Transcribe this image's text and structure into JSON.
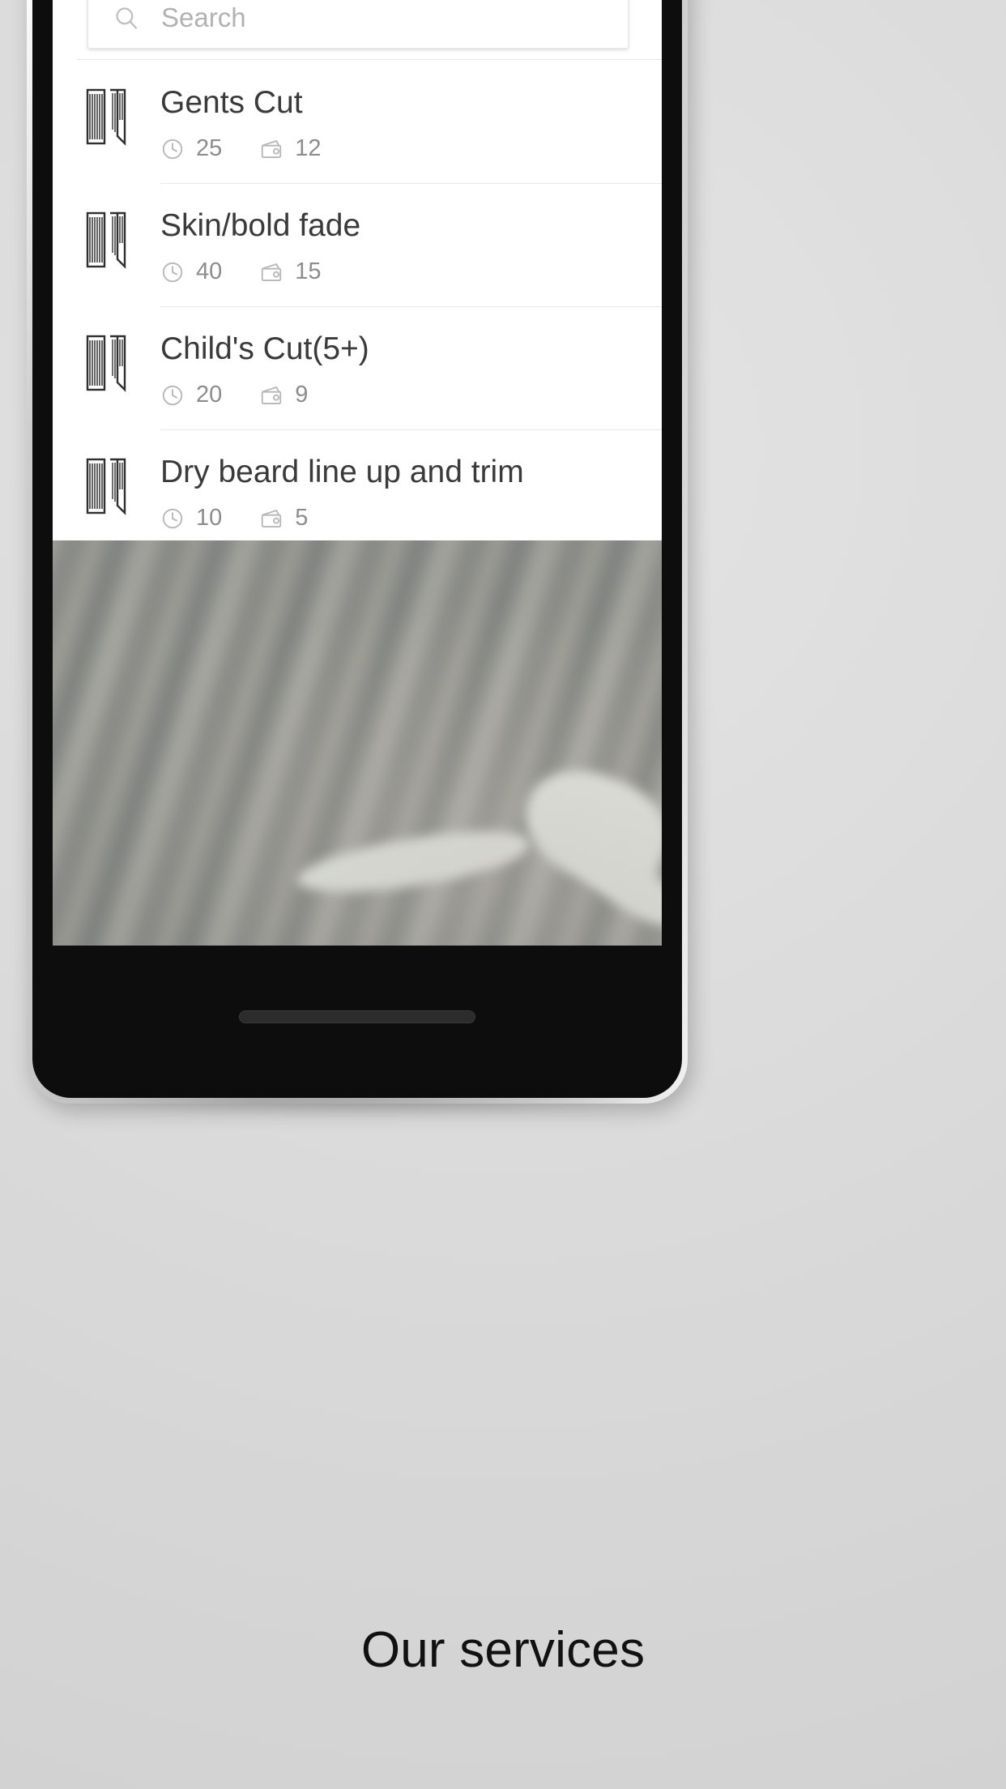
{
  "caption": "Our services",
  "search": {
    "placeholder": "Search",
    "value": "",
    "icon": "search-icon"
  },
  "icons": {
    "service": "comb-icon",
    "duration": "clock-icon",
    "price": "wallet-icon"
  },
  "colors": {
    "screen_background": "#ffffff",
    "page_background": "#dedede",
    "title_text": "#3a3a3a",
    "meta_text": "#8c8c8c",
    "placeholder_text": "#b2b2b2",
    "divider": "#e8e8e8",
    "bezel": "#0d0d0d",
    "caption_text": "#111111"
  },
  "services": [
    {
      "title": "Gents Cut",
      "duration": "25",
      "price": "12"
    },
    {
      "title": "Skin/bold fade",
      "duration": "40",
      "price": "15"
    },
    {
      "title": "Child's Cut(5+)",
      "duration": "20",
      "price": "9"
    },
    {
      "title": "Dry beard line up and trim",
      "duration": "10",
      "price": "5"
    }
  ]
}
